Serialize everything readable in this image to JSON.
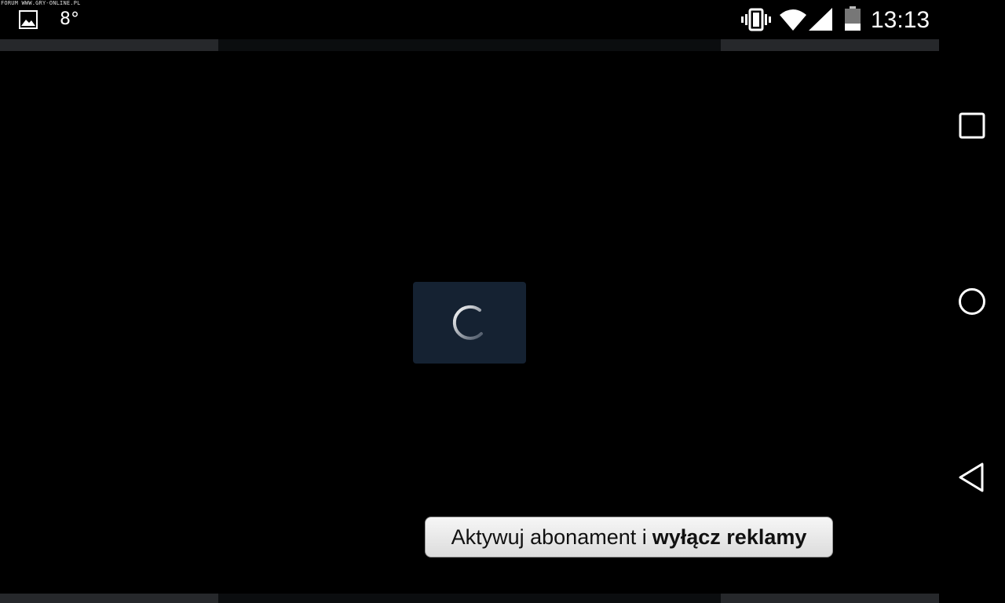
{
  "watermark": "FORUM WWW.GRY-ONLINE.PL",
  "status_bar": {
    "left_icons": [
      "gallery-icon"
    ],
    "temperature": "8°",
    "right_icons": [
      "vibrate-icon",
      "wifi-icon",
      "signal-icon",
      "battery-icon"
    ],
    "time": "13:13"
  },
  "loading": {
    "icon": "spinner-icon"
  },
  "banner": {
    "text_regular": "Aktywuj abonament i",
    "text_bold": "wyłącz reklamy"
  },
  "navigation": {
    "buttons": [
      "recents-icon",
      "home-icon",
      "back-icon"
    ]
  },
  "colors": {
    "background": "#000000",
    "loading_box": "#152232",
    "strip_accent": "#26282b",
    "banner_bg": "#e8e8e8"
  }
}
